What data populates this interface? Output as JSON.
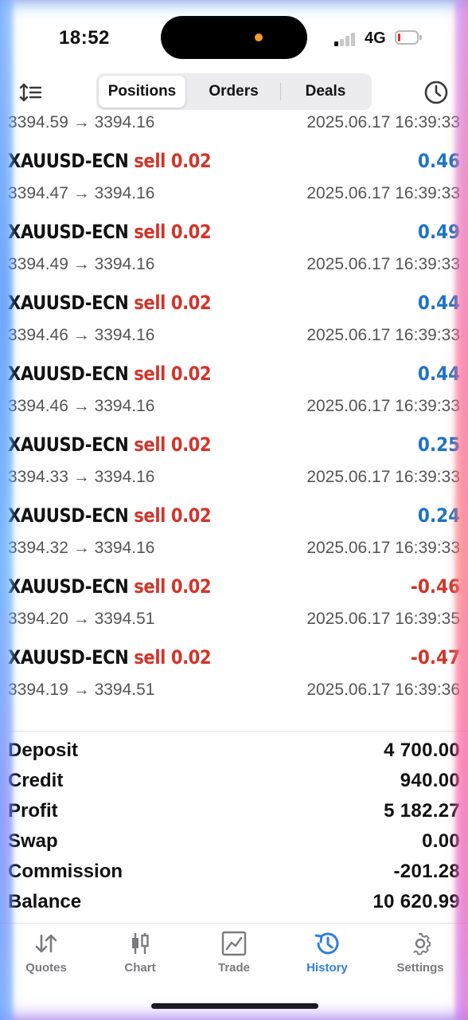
{
  "status_bar": {
    "time": "18:52",
    "network": "4G",
    "battery_level": 0.15,
    "colors": {
      "battery_low": "#e0282e",
      "camera_dot": "#f39a2b"
    }
  },
  "top_nav": {
    "tabs": [
      {
        "label": "Positions",
        "active": true
      },
      {
        "label": "Orders",
        "active": false
      },
      {
        "label": "Deals",
        "active": false
      }
    ],
    "left_icon": "sort-icon",
    "right_icon": "clock-icon"
  },
  "deals": {
    "partial_top": {
      "prices": "3394.59 → 3394.16",
      "time": "2025.06.17 16:39:33"
    },
    "items": [
      {
        "symbol": "XAUUSD-ECN",
        "side": "sell 0.02",
        "profit": "0.46",
        "prices": "3394.47 → 3394.16",
        "time": "2025.06.17 16:39:33"
      },
      {
        "symbol": "XAUUSD-ECN",
        "side": "sell 0.02",
        "profit": "0.49",
        "prices": "3394.49 → 3394.16",
        "time": "2025.06.17 16:39:33"
      },
      {
        "symbol": "XAUUSD-ECN",
        "side": "sell 0.02",
        "profit": "0.44",
        "prices": "3394.46 → 3394.16",
        "time": "2025.06.17 16:39:33"
      },
      {
        "symbol": "XAUUSD-ECN",
        "side": "sell 0.02",
        "profit": "0.44",
        "prices": "3394.46 → 3394.16",
        "time": "2025.06.17 16:39:33"
      },
      {
        "symbol": "XAUUSD-ECN",
        "side": "sell 0.02",
        "profit": "0.25",
        "prices": "3394.33 → 3394.16",
        "time": "2025.06.17 16:39:33"
      },
      {
        "symbol": "XAUUSD-ECN",
        "side": "sell 0.02",
        "profit": "0.24",
        "prices": "3394.32 → 3394.16",
        "time": "2025.06.17 16:39:33"
      },
      {
        "symbol": "XAUUSD-ECN",
        "side": "sell 0.02",
        "profit": "-0.46",
        "prices": "3394.20 → 3394.51",
        "time": "2025.06.17 16:39:35"
      },
      {
        "symbol": "XAUUSD-ECN",
        "side": "sell 0.02",
        "profit": "-0.47",
        "prices": "3394.19 → 3394.51",
        "time": "2025.06.17 16:39:36"
      }
    ],
    "colors": {
      "sell": "#d2352a",
      "positive": "#1e73c8",
      "negative": "#d2352a"
    }
  },
  "summary": {
    "rows": [
      {
        "label": "Deposit",
        "value": "4 700.00"
      },
      {
        "label": "Credit",
        "value": "940.00"
      },
      {
        "label": "Profit",
        "value": "5 182.27"
      },
      {
        "label": "Swap",
        "value": "0.00"
      },
      {
        "label": "Commission",
        "value": "-201.28"
      },
      {
        "label": "Balance",
        "value": "10 620.99"
      }
    ]
  },
  "tab_bar": {
    "tabs": [
      {
        "label": "Quotes",
        "icon": "quotes-icon",
        "active": false
      },
      {
        "label": "Chart",
        "icon": "candlestick-icon",
        "active": false
      },
      {
        "label": "Trade",
        "icon": "trade-icon",
        "active": false
      },
      {
        "label": "History",
        "icon": "history-icon",
        "active": true
      },
      {
        "label": "Settings",
        "icon": "gear-icon",
        "active": false
      }
    ],
    "colors": {
      "active": "#2f7fe0",
      "inactive": "#7a7a7f"
    }
  }
}
